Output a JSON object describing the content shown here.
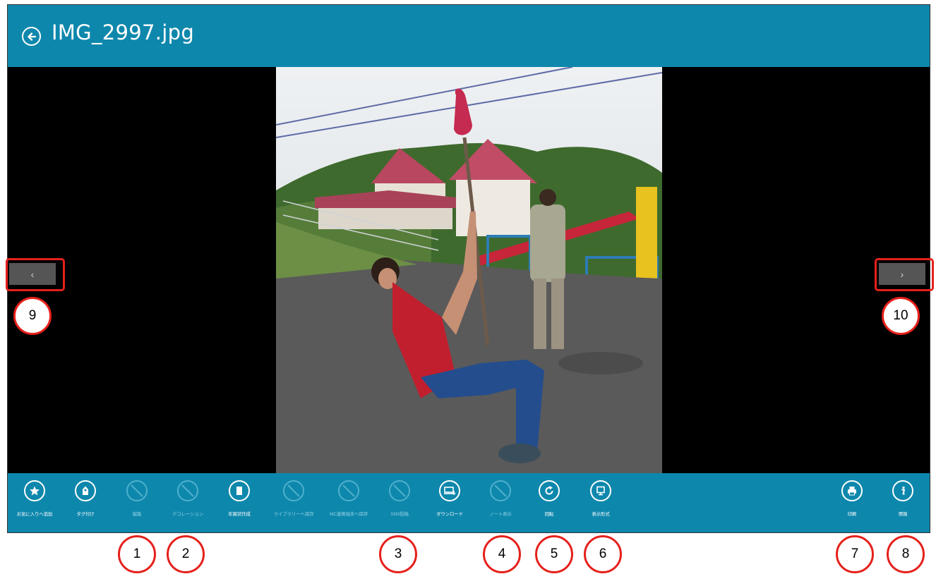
{
  "header": {
    "title": "IMG_2997.jpg",
    "back_icon": "back-arrow-circle-icon"
  },
  "nav": {
    "prev_glyph": "‹",
    "next_glyph": "›"
  },
  "appbar": {
    "left_commands": [
      {
        "label": "お気に入りへ追加",
        "icon": "star-icon",
        "enabled": true
      },
      {
        "label": "タグ付け",
        "icon": "tag-icon",
        "enabled": true
      },
      {
        "label": "編集",
        "icon": "disabled-icon",
        "enabled": false
      },
      {
        "label": "デコレーション",
        "icon": "disabled-icon",
        "enabled": false
      },
      {
        "label": "年賀状作成",
        "icon": "card-icon",
        "enabled": true
      },
      {
        "label": "ライブラリーへ保存",
        "icon": "disabled-icon",
        "enabled": false
      },
      {
        "label": "MC連携端末へ保存",
        "icon": "disabled-icon",
        "enabled": false
      },
      {
        "label": "SNS投稿",
        "icon": "disabled-icon",
        "enabled": false
      },
      {
        "label": "ダウンロード",
        "icon": "download-icon",
        "enabled": true
      },
      {
        "label": "ノート表示",
        "icon": "disabled-icon",
        "enabled": false
      },
      {
        "label": "回転",
        "icon": "rotate-icon",
        "enabled": true
      },
      {
        "label": "表示形式",
        "icon": "display-icon",
        "enabled": true
      }
    ],
    "right_commands": [
      {
        "label": "印刷",
        "icon": "print-icon",
        "enabled": true
      },
      {
        "label": "情報",
        "icon": "info-icon",
        "enabled": true
      }
    ]
  },
  "callouts": [
    "1",
    "2",
    "3",
    "4",
    "5",
    "6",
    "7",
    "8",
    "9",
    "10"
  ],
  "colors": {
    "accent": "#0e87ac",
    "highlight": "#e5201b",
    "viewer_bg": "#000000"
  }
}
